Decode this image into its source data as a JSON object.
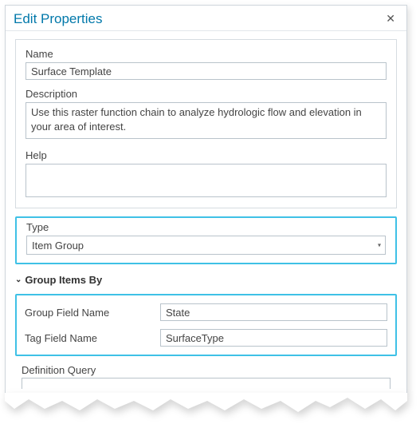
{
  "dialog": {
    "title": "Edit Properties"
  },
  "fields": {
    "name_label": "Name",
    "name_value": "Surface Template",
    "desc_label": "Description",
    "desc_value": "Use this raster function chain to analyze hydrologic flow and elevation in your area of interest.",
    "help_label": "Help",
    "help_value": "",
    "type_label": "Type",
    "type_value": "Item Group"
  },
  "group_section": {
    "header": "Group Items By",
    "group_field_label": "Group Field Name",
    "group_field_value": "State",
    "tag_field_label": "Tag Field Name",
    "tag_field_value": "SurfaceType"
  },
  "defq_label": "Definition Query",
  "colors": {
    "highlight": "#3fc1e6",
    "title": "#0078aa"
  }
}
